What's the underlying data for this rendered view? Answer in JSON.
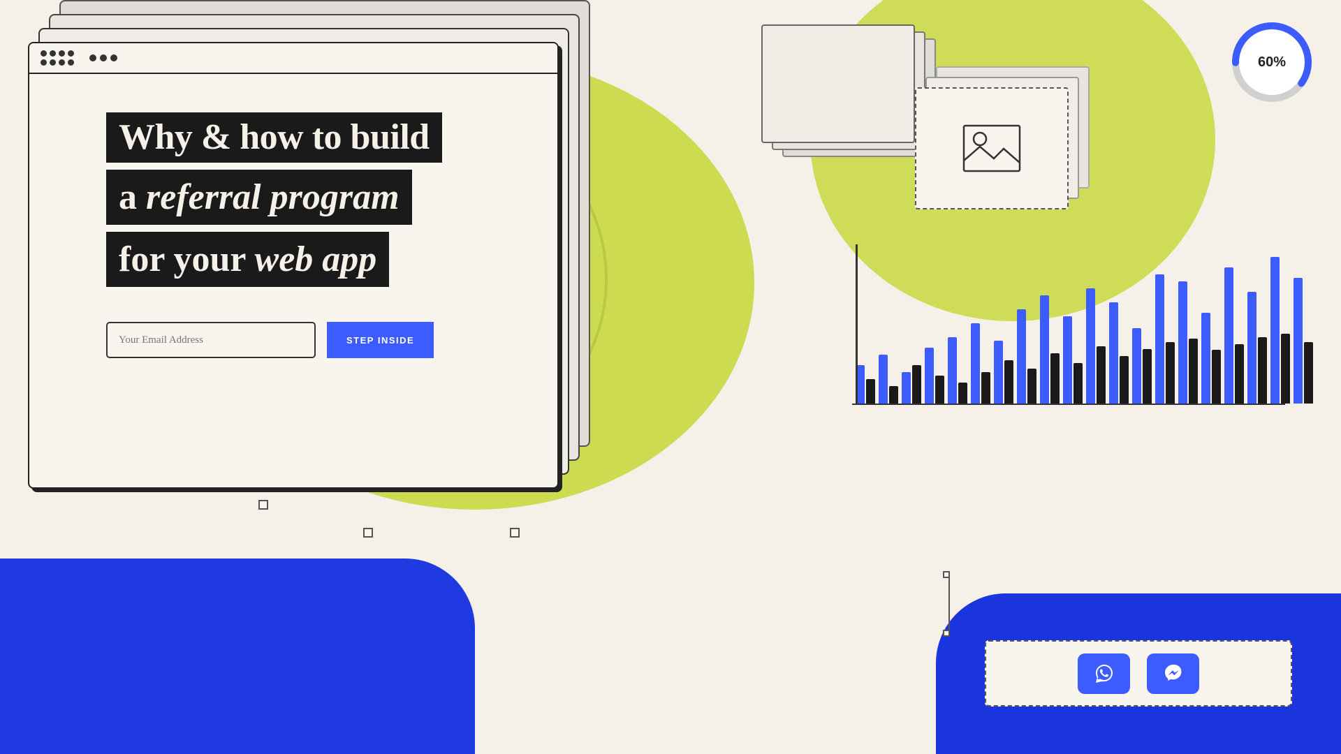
{
  "page": {
    "background_color": "#f5f0e8",
    "title": "Why & how to build a referral program for your web app"
  },
  "hero": {
    "title_line1": "Why & how to build",
    "title_line2": "a ",
    "title_line2_italic": "referral program",
    "title_line3": "for your ",
    "title_line3_italic": "web app"
  },
  "form": {
    "email_placeholder": "Your Email Address",
    "button_label": "STEP INSIDE"
  },
  "progress": {
    "value": 60,
    "label": "60%",
    "color": "#3d5cff",
    "track_color": "#d0d0d0"
  },
  "chart": {
    "bars": [
      {
        "blue": 60,
        "dark": 40
      },
      {
        "blue": 80,
        "dark": 30
      },
      {
        "blue": 50,
        "dark": 60
      },
      {
        "blue": 90,
        "dark": 45
      },
      {
        "blue": 110,
        "dark": 35
      },
      {
        "blue": 130,
        "dark": 50
      },
      {
        "blue": 100,
        "dark": 70
      },
      {
        "blue": 150,
        "dark": 55
      },
      {
        "blue": 170,
        "dark": 80
      },
      {
        "blue": 140,
        "dark": 65
      },
      {
        "blue": 180,
        "dark": 90
      },
      {
        "blue": 160,
        "dark": 75
      },
      {
        "blue": 120,
        "dark": 85
      },
      {
        "blue": 200,
        "dark": 95
      },
      {
        "blue": 190,
        "dark": 100
      }
    ]
  },
  "social": {
    "whatsapp_icon": "💬",
    "messenger_icon": "💬"
  },
  "colors": {
    "yellow_blob": "#c8d83e",
    "blue_accent": "#2040e8",
    "cta_blue": "#3d5cff",
    "dark": "#1a1a1a",
    "cream": "#f8f5ee"
  }
}
